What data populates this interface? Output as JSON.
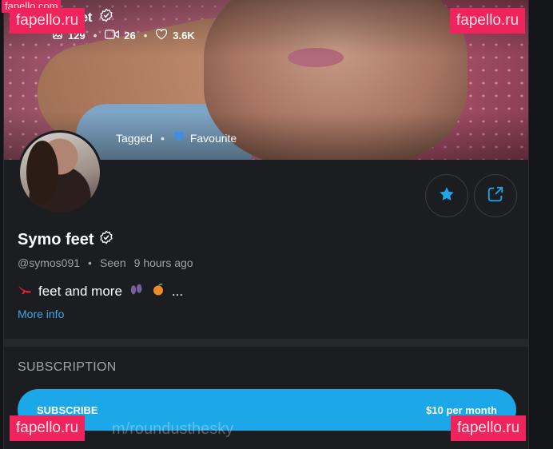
{
  "profile": {
    "display_name": "Symo feet",
    "cover_name_fragment": "eet",
    "handle": "@symos091",
    "seen_label": "Seen",
    "seen_time": "9 hours ago",
    "bio_text": "feet and more",
    "bio_suffix": "...",
    "more_info": "More info",
    "stats": {
      "photos": "129",
      "videos": "26",
      "likes": "3.6K"
    },
    "tagged_label": "Tagged",
    "favourite_label": "Favourite"
  },
  "subscription": {
    "section_title": "SUBSCRIPTION",
    "button_label": "SUBSCRIBE",
    "price": "$10 per month"
  },
  "watermark": {
    "brand": "fapello.ru",
    "top_small": "fapello.com",
    "url_fragment": "m/roundusthesky"
  },
  "colors": {
    "accent": "#1ba7e8",
    "watermark": "#f0245c",
    "background": "#1c1d21"
  },
  "icons": [
    "verified-check-icon",
    "photo-icon",
    "video-icon",
    "heart-icon",
    "blue-heart-icon",
    "star-icon",
    "share-icon",
    "back-arrow-icon",
    "more-icon",
    "high-heel-icon",
    "footprints-icon",
    "peach-icon"
  ]
}
